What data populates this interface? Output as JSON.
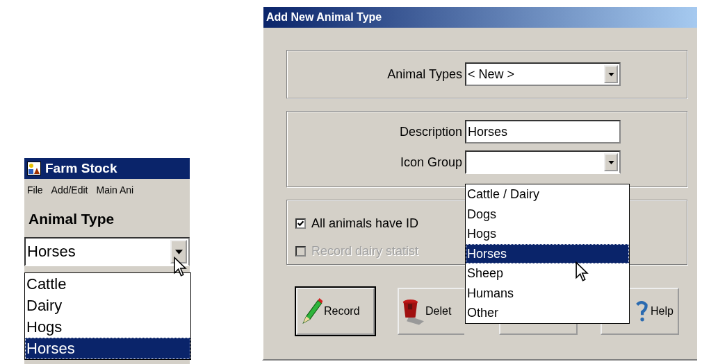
{
  "farm_stock": {
    "window": {
      "title": "Farm Stock"
    },
    "menu": [
      "File",
      "Add/Edit",
      "Main Ani"
    ],
    "heading": "Animal Type",
    "combo": {
      "value": "Horses",
      "expanded": true
    },
    "options": [
      {
        "label": "Cattle",
        "selected": false
      },
      {
        "label": "Dairy",
        "selected": false
      },
      {
        "label": "Hogs",
        "selected": false
      },
      {
        "label": "Horses",
        "selected": true
      }
    ]
  },
  "dialog": {
    "window": {
      "title": "Add New Animal Type"
    },
    "animal_types": {
      "label": "Animal Types",
      "value": "< New >"
    },
    "description": {
      "label": "Description",
      "value": "Horses"
    },
    "icon_group": {
      "label": "Icon Group",
      "expanded": true,
      "options": [
        {
          "label": "Cattle / Dairy",
          "selected": false
        },
        {
          "label": "Dogs",
          "selected": false
        },
        {
          "label": "Hogs",
          "selected": false
        },
        {
          "label": "Horses",
          "selected": true
        },
        {
          "label": "Sheep",
          "selected": false
        },
        {
          "label": "Humans",
          "selected": false
        },
        {
          "label": "Other",
          "selected": false
        }
      ]
    },
    "checkboxes": [
      {
        "label": "All animals have ID",
        "checked": true,
        "disabled": false
      },
      {
        "label": "Record dairy statist",
        "checked": false,
        "disabled": true
      }
    ],
    "buttons": [
      {
        "kind": "record",
        "label": "Record"
      },
      {
        "kind": "delete",
        "label": "Delet"
      },
      {
        "kind": "covered"
      },
      {
        "kind": "help",
        "label": "Help"
      }
    ]
  }
}
